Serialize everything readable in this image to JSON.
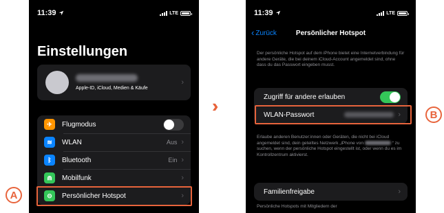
{
  "colors": {
    "accent": "#e8643c",
    "toggle_on": "#34c759",
    "link": "#0a84ff"
  },
  "left_phone": {
    "status": {
      "time": "11:39",
      "network": "LTE"
    },
    "title": "Einstellungen",
    "account": {
      "subtitle": "Apple-ID, iCloud, Medien & Käufe"
    },
    "items": [
      {
        "label": "Flugmodus",
        "icon": "airplane-icon",
        "glyph": "✈",
        "color": "#ff9500",
        "value": ""
      },
      {
        "label": "WLAN",
        "icon": "wifi-icon",
        "glyph": "≋",
        "color": "#0a84ff",
        "value": "Aus"
      },
      {
        "label": "Bluetooth",
        "icon": "bluetooth-icon",
        "glyph": "ᛒ",
        "color": "#0a84ff",
        "value": "Ein"
      },
      {
        "label": "Mobilfunk",
        "icon": "antenna-icon",
        "glyph": "⋒",
        "color": "#34c759",
        "value": ""
      },
      {
        "label": "Persönlicher Hotspot",
        "icon": "hotspot-icon",
        "glyph": "⊝",
        "color": "#34c759",
        "value": ""
      }
    ],
    "airplane_mode_on": false
  },
  "right_phone": {
    "status": {
      "time": "11:39",
      "network": "LTE"
    },
    "nav": {
      "back_label": "Zurück",
      "title": "Persönlicher Hotspot"
    },
    "intro_text": "Der persönliche Hotspot auf dem iPhone bietet eine Internetverbindung für andere Geräte, die bei deinem iCloud-Account angemeldet sind, ohne dass du das Passwort eingeben musst.",
    "allow_label": "Zugriff für andere erlauben",
    "allow_on": true,
    "wifi_password_label": "WLAN-Passwort",
    "info_text_1": "Erlaube anderen Benutzer:innen oder Geräten, die nicht bei iCloud angemeldet sind, dein geteiltes Netzwerk „iPhone von",
    "info_text_2": "“ zu suchen, wenn der persönliche Hotspot eingestellt ist, oder wenn du es im Kontrollzentrum aktivierst.",
    "family_label": "Familienfreigabe",
    "family_text": "Persönliche Hotspots mit Mitgliedern der"
  },
  "annotations": {
    "a": "A",
    "b": "B"
  }
}
